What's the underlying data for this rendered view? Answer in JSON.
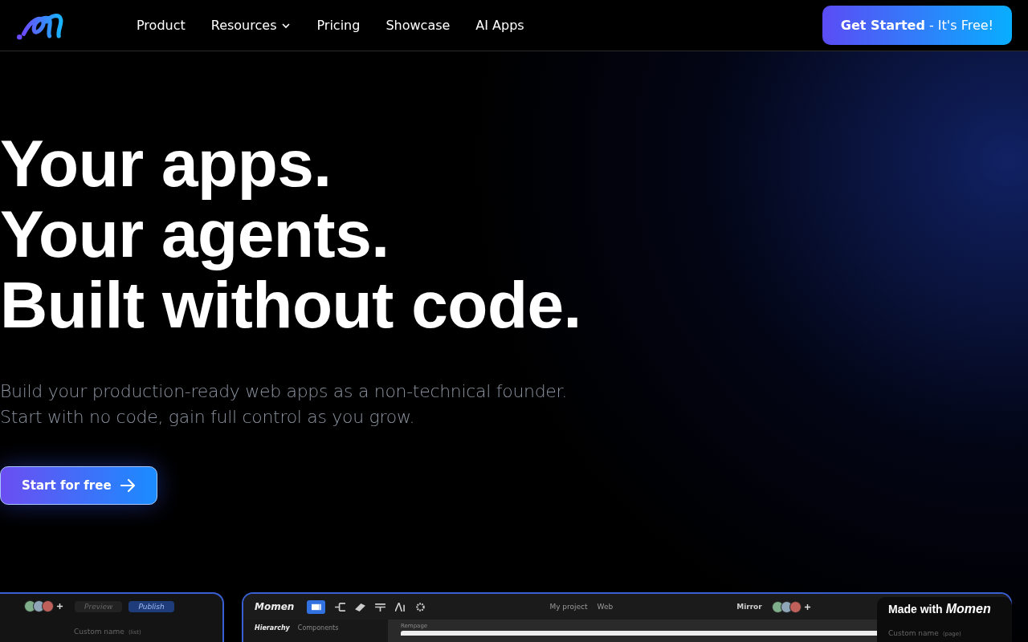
{
  "nav": {
    "links": [
      {
        "label": "Product",
        "dropdown": false
      },
      {
        "label": "Resources",
        "dropdown": true
      },
      {
        "label": "Pricing",
        "dropdown": false
      },
      {
        "label": "Showcase",
        "dropdown": false
      },
      {
        "label": "AI Apps",
        "dropdown": false
      }
    ],
    "cta": "**Get Started** - It's Free!"
  },
  "hero": {
    "headline": [
      "Your apps.",
      "Your agents.",
      "Built without code."
    ],
    "subtitle": [
      "Build your production-ready web apps as a non-technical founder.",
      "Start with no code, gain full control as you grow."
    ],
    "button": "Start for free"
  },
  "preview_left": {
    "buttons": [
      "Preview",
      "Publish"
    ],
    "field": "Custom name",
    "field_tag": "(list)"
  },
  "preview_main": {
    "logo": "Momen",
    "tabs": [
      {
        "label": "Hierarchy",
        "selected": true
      },
      {
        "label": "Components",
        "selected": false
      }
    ],
    "canvas_label": "Rempage",
    "project": "My project",
    "platform": "Web",
    "mirror": "Mirror",
    "field": "Custom name",
    "field_tag": "(page)"
  },
  "badge": {
    "text": "Made with",
    "logo": "Momen"
  }
}
